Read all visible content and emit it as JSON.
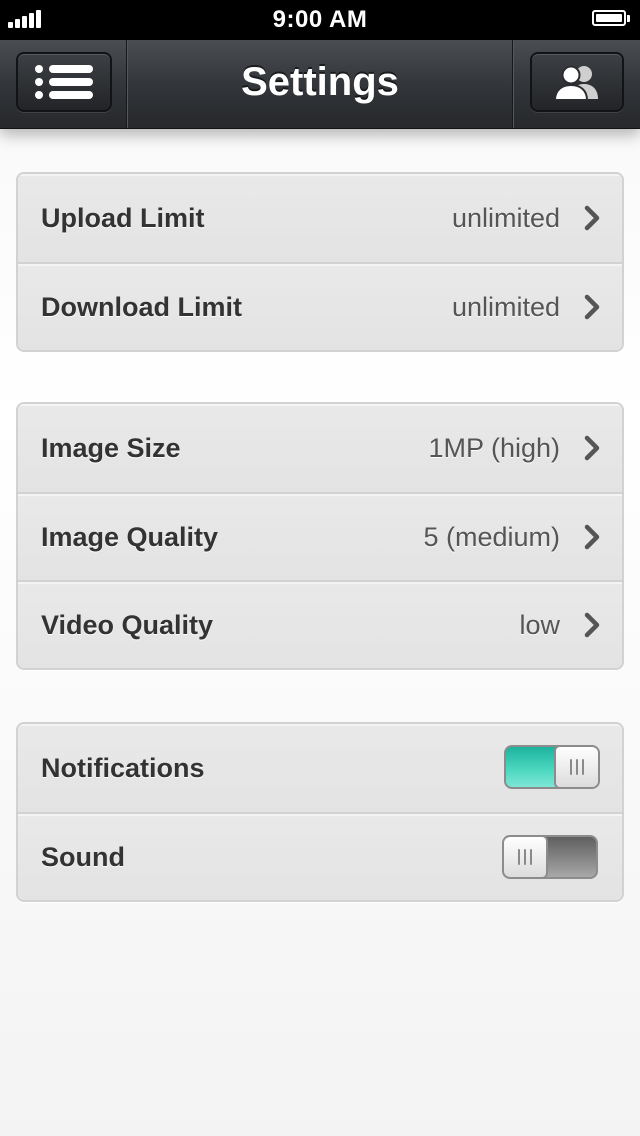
{
  "status_bar": {
    "time": "9:00 AM",
    "signal_bars": 5,
    "battery_icon": "battery-full-icon"
  },
  "nav": {
    "title": "Settings",
    "left_button_icon": "menu-list-icon",
    "right_button_icon": "users-icon"
  },
  "groups": [
    {
      "rows": [
        {
          "label": "Upload Limit",
          "value": "unlimited"
        },
        {
          "label": "Download Limit",
          "value": "unlimited"
        }
      ]
    },
    {
      "rows": [
        {
          "label": "Image Size",
          "value": "1MP (high)"
        },
        {
          "label": "Image Quality",
          "value": "5 (medium)"
        },
        {
          "label": "Video Quality",
          "value": "low"
        }
      ]
    },
    {
      "rows": [
        {
          "label": "Notifications",
          "toggle": true
        },
        {
          "label": "Sound",
          "toggle": false
        }
      ]
    }
  ],
  "colors": {
    "toggle_on": "#4fd9c1",
    "nav_background": "#33363a",
    "row_background": "#e6e6e6"
  }
}
